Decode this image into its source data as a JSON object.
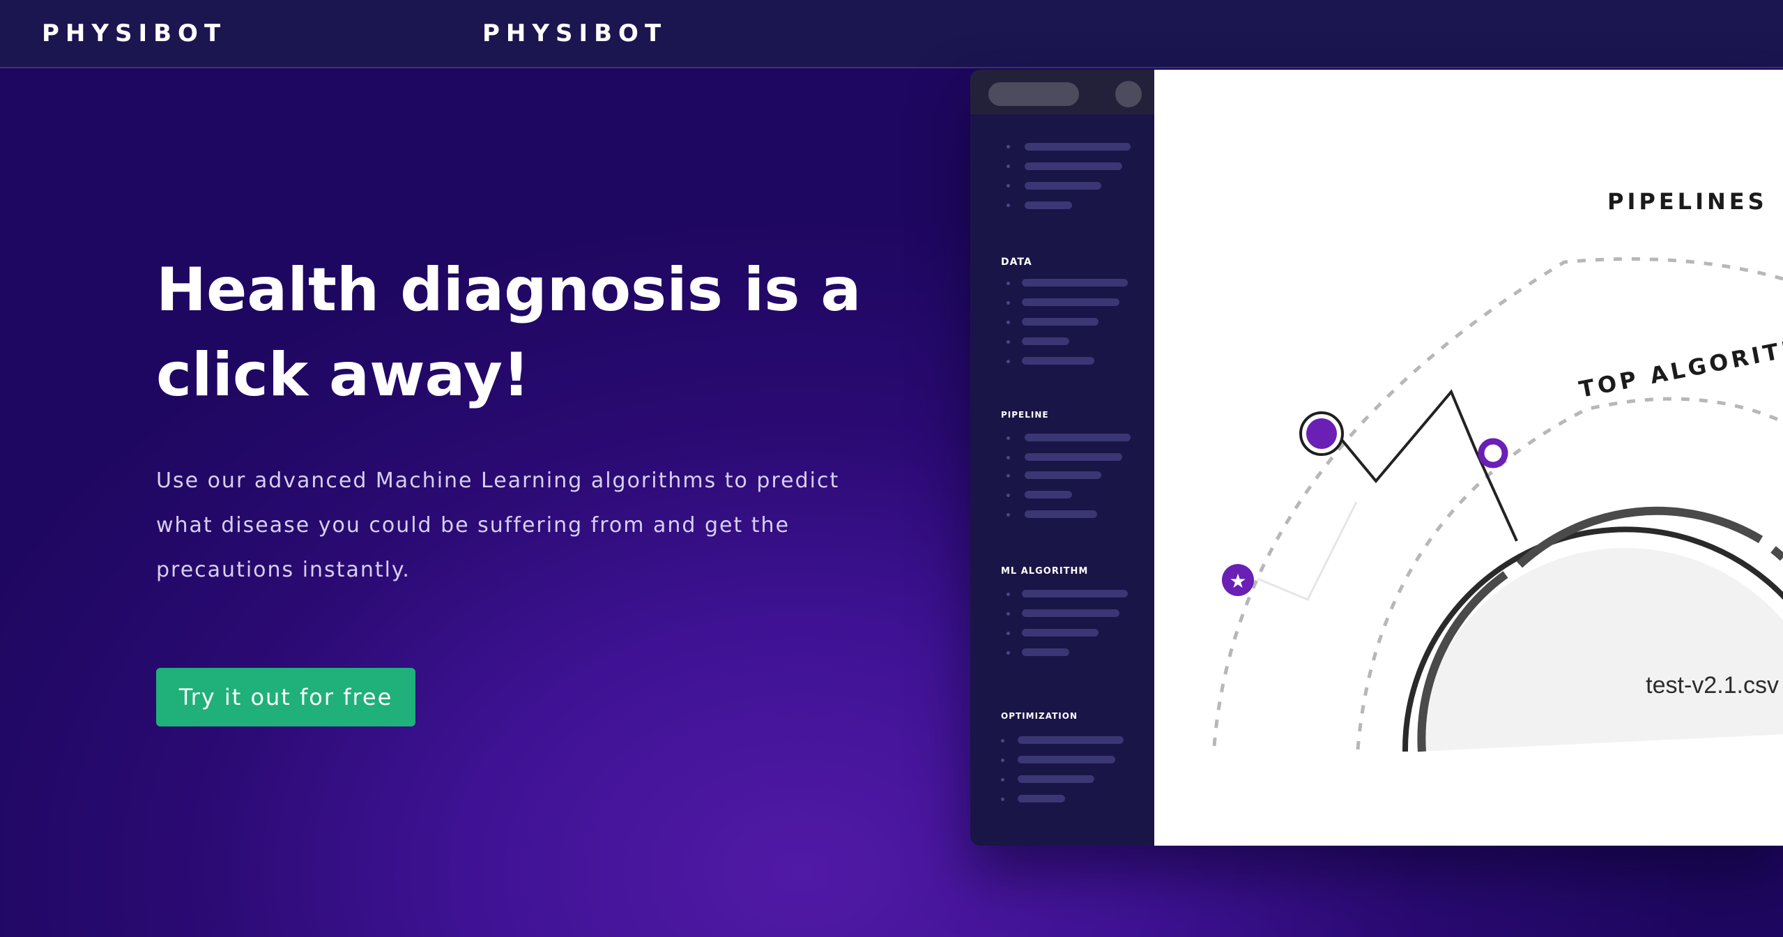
{
  "navbar": {
    "brand_left": "PHYSIBOT",
    "brand_center": "PHYSIBOT"
  },
  "hero": {
    "title_line1": "Health diagnosis is a",
    "title_line2": "click away!",
    "desc_line1": "Use our advanced Machine Learning algorithms to predict",
    "desc_line2": "what disease you could be suffering from and get the",
    "desc_line3": "precautions instantly.",
    "cta_label": "Try it out for free"
  },
  "mockup": {
    "sections": [
      "DATA",
      "PIPELINE",
      "ML ALGORITHM",
      "OPTIMIZATION"
    ],
    "labels": {
      "pipelines": "PIPELINES",
      "top_algorithm": "TOP ALGORITH",
      "file": "test-v2.1.csv"
    }
  },
  "colors": {
    "accent": "#20b07a",
    "navbar": "#1b1550",
    "node_purple": "#6a1fb5"
  }
}
